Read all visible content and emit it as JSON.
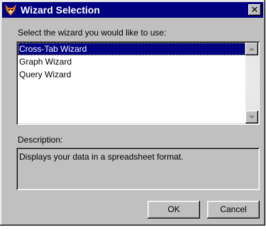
{
  "window": {
    "title": "Wizard Selection",
    "icon": "fox-icon",
    "close_label": "✕"
  },
  "prompt": "Select the wizard you would like to use:",
  "wizard_list": {
    "items": [
      {
        "label": "Cross-Tab Wizard",
        "selected": true
      },
      {
        "label": "Graph Wizard",
        "selected": false
      },
      {
        "label": "Query Wizard",
        "selected": false
      }
    ]
  },
  "description": {
    "label": "Description:",
    "text": "Displays your data in a spreadsheet format."
  },
  "buttons": {
    "ok_label": "OK",
    "cancel_label": "Cancel"
  },
  "colors": {
    "titlebar": "#000080",
    "face": "#c0c0c0",
    "selection": "#000080",
    "fox": "#e07010"
  }
}
